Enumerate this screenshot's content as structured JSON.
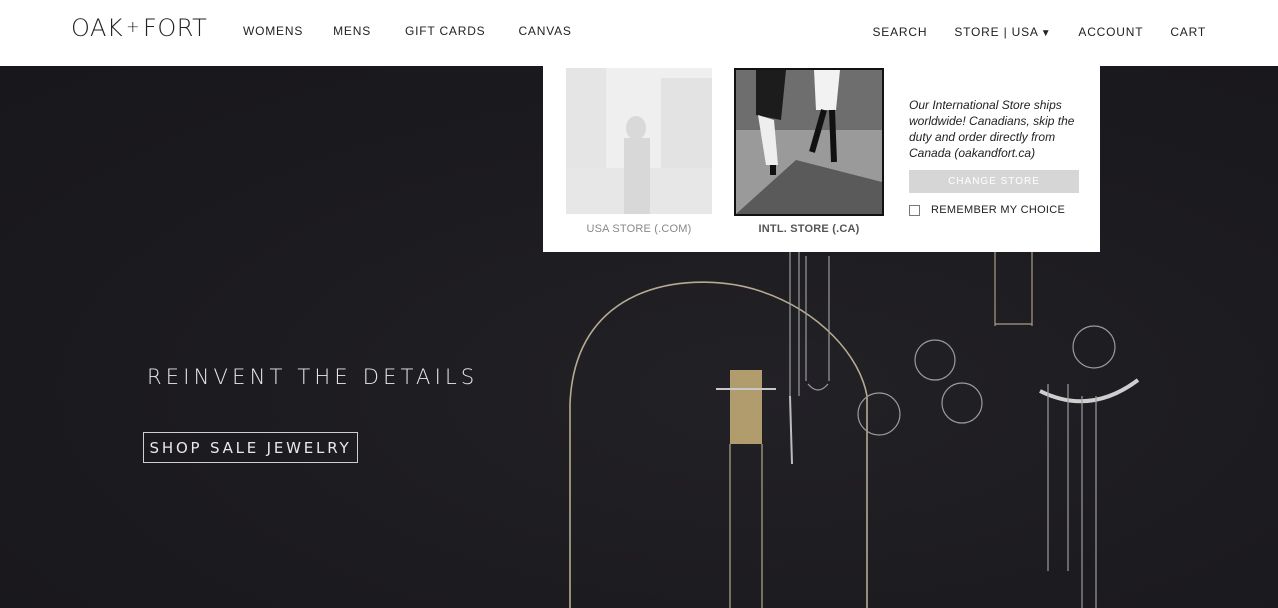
{
  "header": {
    "logo_left": "OAK",
    "logo_plus": "+",
    "logo_right": "FORT",
    "nav_left": [
      {
        "label": "WOMENS"
      },
      {
        "label": "MENS"
      },
      {
        "label": "GIFT CARDS"
      },
      {
        "label": "CANVAS"
      }
    ],
    "search_label": "SEARCH",
    "store_label": "STORE | USA",
    "store_caret": "▼",
    "account_label": "ACCOUNT",
    "cart_label": "CART"
  },
  "hero": {
    "tagline": "REINVENT THE DETAILS",
    "cta_label": "SHOP SALE JEWELRY",
    "background_color": "#1b1a1e"
  },
  "store_popup": {
    "usa_label": "USA STORE (.COM)",
    "intl_label": "INTL. STORE (.CA)",
    "info_text": "Our International Store ships worldwide! Canadians, skip the duty and order directly from Canada (oakandfort.ca)",
    "change_button": "CHANGE STORE",
    "remember_label": "REMEMBER MY CHOICE",
    "remember_checked": false
  }
}
